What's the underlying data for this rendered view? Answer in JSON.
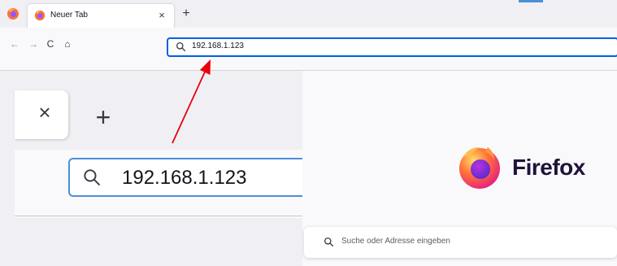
{
  "browser": {
    "tab": {
      "title": "Neuer Tab",
      "close_glyph": "×"
    },
    "new_tab_glyph": "+",
    "nav": {
      "back_glyph": "←",
      "forward_glyph": "→",
      "reload_glyph": "C",
      "home_glyph": "⌂"
    },
    "urlbar": {
      "value": "192.168.1.123",
      "icon": "search-icon"
    }
  },
  "zoom_inset": {
    "tab_close_glyph": "×",
    "new_tab_glyph": "+",
    "url_value": "192.168.1.123"
  },
  "newtab_page": {
    "brand_name": "Firefox",
    "search_placeholder": "Suche oder Adresse eingeben"
  },
  "annotation": {
    "type": "arrow",
    "color": "#e8000b"
  },
  "colors": {
    "accent": "#0061e0",
    "zoom_focus": "#4a90d9",
    "firefox_orange": "#ff7139",
    "firefox_purple": "#9059ff"
  }
}
